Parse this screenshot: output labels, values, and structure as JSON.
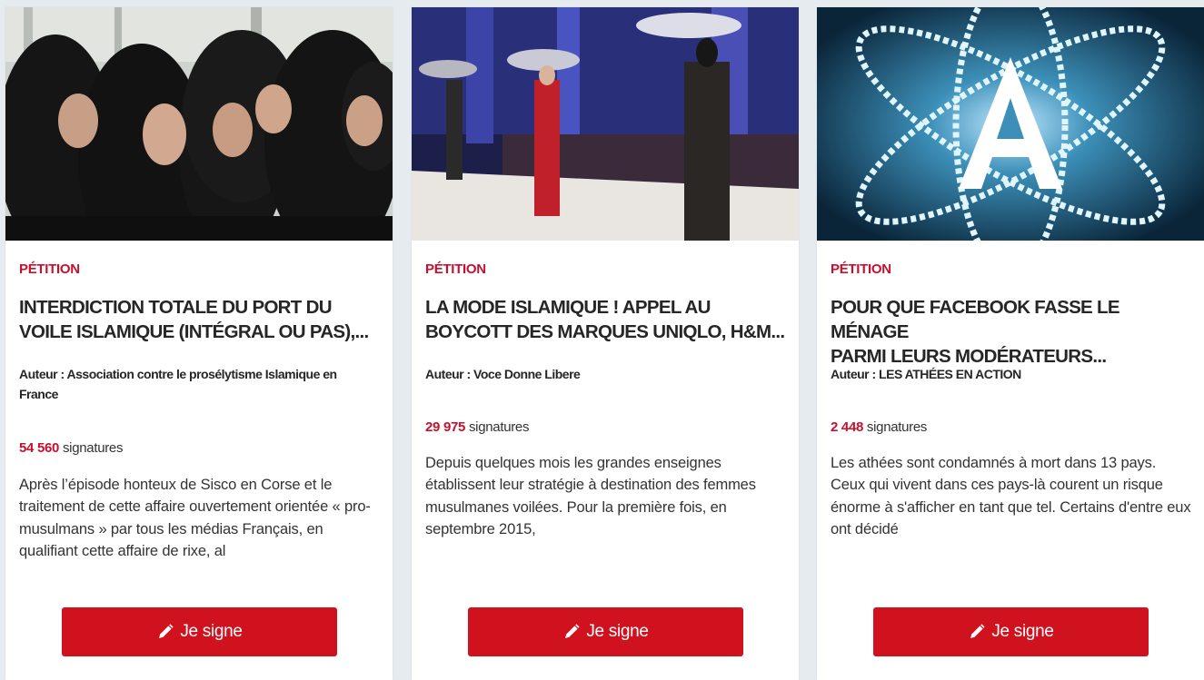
{
  "cards": [
    {
      "category": "PÉTITION",
      "title": "INTERDICTION TOTALE DU PORT DU\nVOILE ISLAMIQUE (INTÉGRAL OU PAS),...",
      "author": "Auteur : Association contre le prosélytisme Islamique en France",
      "signatures_count": "54 560",
      "signatures_label": " signatures",
      "description": "Après l’épisode honteux de Sisco en Corse et le traitement de cette affaire ouvertement orientée « pro-musulmans » par tous les médias Français, en qualifiant cette affaire de rixe, al",
      "button_label": "Je signe",
      "image_icon": "women-in-niqab-photo"
    },
    {
      "category": "PÉTITION",
      "title": "LA MODE ISLAMIQUE ! APPEL AU\nBOYCOTT DES MARQUES UNIQLO, H&M...",
      "author": "Auteur : Voce Donne Libere",
      "signatures_count": "29 975",
      "signatures_label": " signatures",
      "description": "Depuis quelques mois les grandes enseignes établissent leur stratégie à destination des femmes musulmanes voilées. Pour la première fois, en septembre 2015,",
      "button_label": "Je signe",
      "image_icon": "fashion-runway-photo"
    },
    {
      "category": "PÉTITION",
      "title": "POUR QUE FACEBOOK FASSE LE MÉNAGE\nPARMI LEURS MODÉRATEURS...",
      "author": "Auteur : LES ATHÉES EN ACTION",
      "signatures_count": "2 448",
      "signatures_label": " signatures",
      "description": "Les athées sont condamnés à mort dans 13 pays. Ceux qui vivent dans ces pays-là courent un risque énorme à s'afficher en tant que tel. Certains d'entre eux ont décidé",
      "button_label": "Je signe",
      "image_icon": "atheist-atom-logo-photo"
    }
  ],
  "colors": {
    "accent_red": "#c8102e",
    "button_red": "#d0121f",
    "page_background": "#e6ebef",
    "card_background": "#ffffff"
  }
}
